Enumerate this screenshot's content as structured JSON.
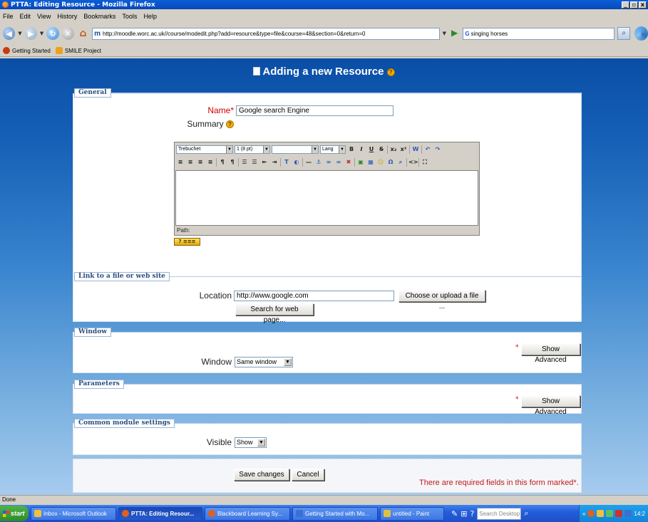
{
  "window": {
    "title": "PTTA: Editing Resource - Mozilla Firefox"
  },
  "menu": [
    {
      "label": "File"
    },
    {
      "label": "Edit"
    },
    {
      "label": "View"
    },
    {
      "label": "History"
    },
    {
      "label": "Bookmarks"
    },
    {
      "label": "Tools"
    },
    {
      "label": "Help"
    }
  ],
  "nav": {
    "url": "http://moodle.worc.ac.uk//course/modedit.php?add=resource&type=file&course=48&section=0&return=0",
    "search_value": "singing horses",
    "search_engine": "G",
    "home_glyph": "⌂"
  },
  "bookmarks": [
    {
      "label": "Getting Started",
      "color": "#c83a10"
    },
    {
      "label": "SMILE Project",
      "color": "#f0a020"
    }
  ],
  "page": {
    "heading": "Adding a new Resource",
    "sections": {
      "general": "General",
      "link": "Link to a file or web site",
      "window": "Window",
      "parameters": "Parameters",
      "common": "Common module settings"
    },
    "name_label": "Name",
    "required_star": "*",
    "name_value": "Google search Engine",
    "summary_label": "Summary",
    "editor": {
      "font": "Trebuchet",
      "size": "1 (8 pt)",
      "format": "",
      "lang": "Lang",
      "path_label": "Path:",
      "help_badge": "? ≡≡≡"
    },
    "location_label": "Location",
    "location_value": "http://www.google.com",
    "choose_button": "Choose or upload a file ...",
    "search_web_button": "Search for web page...",
    "show_advanced": "Show Advanced",
    "window_label": "Window",
    "window_value": "Same window",
    "visible_label": "Visible",
    "visible_value": "Show",
    "save_button": "Save changes",
    "cancel_button": "Cancel",
    "required_note": "There are required fields in this form marked*."
  },
  "status": "Done",
  "taskbar": {
    "start": "start",
    "tasks": [
      {
        "label": "Inbox - Microsoft Outlook",
        "color": "#f0c040",
        "active": false
      },
      {
        "label": "PTTA: Editing Resour...",
        "color": "#e06020",
        "active": true
      },
      {
        "label": "Blackboard Learning Sy...",
        "color": "#e06020",
        "active": false
      },
      {
        "label": "Getting Started with Mo...",
        "color": "#3a70d0",
        "active": false
      },
      {
        "label": "untitled - Paint",
        "color": "#e0c040",
        "active": false
      }
    ],
    "search_placeholder": "Search Desktop",
    "clock": "14:2"
  }
}
